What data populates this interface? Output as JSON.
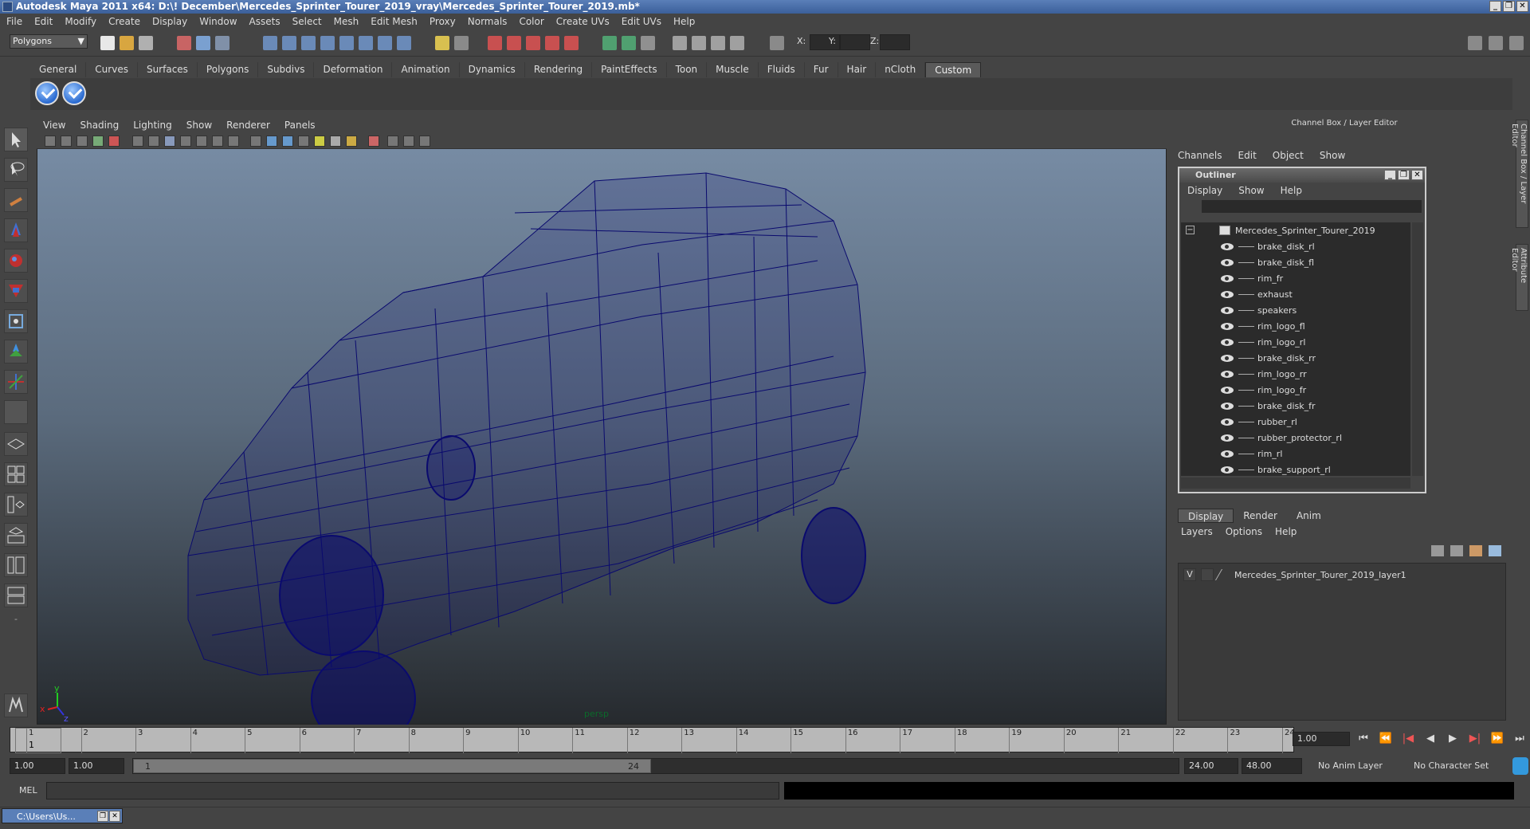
{
  "window": {
    "title": "Autodesk Maya 2011 x64: D:\\! December\\Mercedes_Sprinter_Tourer_2019_vray\\Mercedes_Sprinter_Tourer_2019.mb*",
    "minimize": "_",
    "restore": "❐",
    "close": "✕"
  },
  "menubar": [
    "File",
    "Edit",
    "Modify",
    "Create",
    "Display",
    "Window",
    "Assets",
    "Select",
    "Mesh",
    "Edit Mesh",
    "Proxy",
    "Normals",
    "Color",
    "Create UVs",
    "Edit UVs",
    "Help"
  ],
  "statusline": {
    "mode": "Polygons",
    "x_label": "X:",
    "y_label": "Y:",
    "z_label": "Z:"
  },
  "shelf": {
    "tabs": [
      "General",
      "Curves",
      "Surfaces",
      "Polygons",
      "Subdivs",
      "Deformation",
      "Animation",
      "Dynamics",
      "Rendering",
      "PaintEffects",
      "Toon",
      "Muscle",
      "Fluids",
      "Fur",
      "Hair",
      "nCloth",
      "Custom"
    ],
    "active_tab": "Custom"
  },
  "viewport": {
    "menu": [
      "View",
      "Shading",
      "Lighting",
      "Show",
      "Renderer",
      "Panels"
    ],
    "camera_label": "persp",
    "axis_x": "x",
    "axis_y": "y",
    "axis_z": "z",
    "wire_color": "#0a0a6e"
  },
  "channelbox": {
    "title": "Channel Box / Layer Editor",
    "menu": [
      "Channels",
      "Edit",
      "Object",
      "Show"
    ]
  },
  "outliner": {
    "title": "Outliner",
    "menu": [
      "Display",
      "Show",
      "Help"
    ],
    "collapse": "−",
    "root": "Mercedes_Sprinter_Tourer_2019",
    "items": [
      "brake_disk_rl",
      "brake_disk_fl",
      "rim_fr",
      "exhaust",
      "speakers",
      "rim_logo_fl",
      "rim_logo_rl",
      "brake_disk_rr",
      "rim_logo_rr",
      "rim_logo_fr",
      "brake_disk_fr",
      "rubber_rl",
      "rubber_protector_rl",
      "rim_rl",
      "brake_support_rl"
    ]
  },
  "layereditor": {
    "tabs": [
      "Display",
      "Render",
      "Anim"
    ],
    "active_tab": "Display",
    "menu": [
      "Layers",
      "Options",
      "Help"
    ],
    "layer_visible": "V",
    "layer_name": "Mercedes_Sprinter_Tourer_2019_layer1"
  },
  "sidetabs": [
    "Channel Box / Layer Editor",
    "Attribute Editor"
  ],
  "timeslider": {
    "ticks": [
      "1",
      "2",
      "3",
      "4",
      "5",
      "6",
      "7",
      "8",
      "9",
      "10",
      "11",
      "12",
      "13",
      "14",
      "15",
      "16",
      "17",
      "18",
      "19",
      "20",
      "21",
      "22",
      "23",
      "24"
    ],
    "current_frame": "1",
    "current_frame_field": "1.00"
  },
  "playback": [
    "⏮",
    "⏪",
    "|◀",
    "◀",
    "▶",
    "▶|",
    "⏩",
    "⏭"
  ],
  "range": {
    "start": "1.00",
    "playback_start": "1.00",
    "thumb_start": "1",
    "thumb_end": "24",
    "playback_end": "24.00",
    "end": "48.00",
    "anim_layer": "No Anim Layer",
    "character_set": "No Character Set"
  },
  "mel": {
    "label": "MEL"
  },
  "taskbar": {
    "item": "C:\\Users\\Us..."
  }
}
